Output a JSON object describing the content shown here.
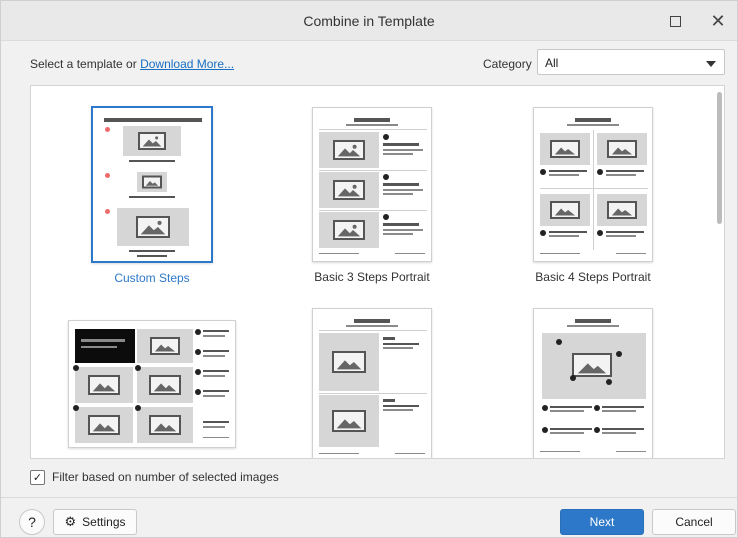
{
  "window": {
    "title": "Combine in Template"
  },
  "toolbar": {
    "prompt": "Select a template or ",
    "download_link": "Download More...",
    "category_label": "Category",
    "category_value": "All"
  },
  "templates": [
    {
      "label": "Custom Steps",
      "selected": true
    },
    {
      "label": "Basic 3 Steps Portrait",
      "selected": false
    },
    {
      "label": "Basic 4 Steps Portrait",
      "selected": false
    },
    {
      "label": "",
      "selected": false
    },
    {
      "label": "",
      "selected": false
    },
    {
      "label": "",
      "selected": false
    }
  ],
  "filter": {
    "label": "Filter based on number of selected images",
    "checked": true
  },
  "footer": {
    "help_label": "?",
    "settings_label": "Settings",
    "next_label": "Next",
    "cancel_label": "Cancel"
  },
  "colors": {
    "accent": "#2d78c8",
    "marker_red": "#ee6b6b"
  }
}
